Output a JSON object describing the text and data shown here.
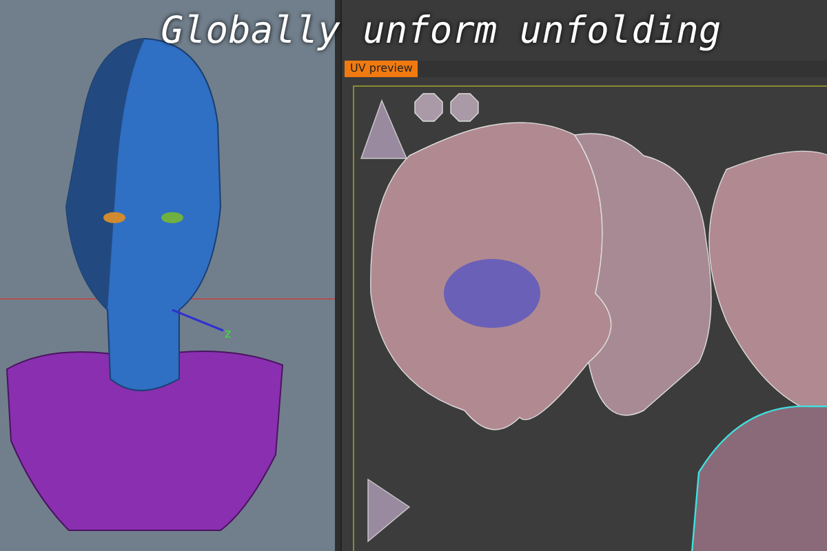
{
  "title": "Globally unform unfolding",
  "viewport": {
    "axis_label": "z"
  },
  "uv_panel": {
    "tab": "UV preview"
  }
}
